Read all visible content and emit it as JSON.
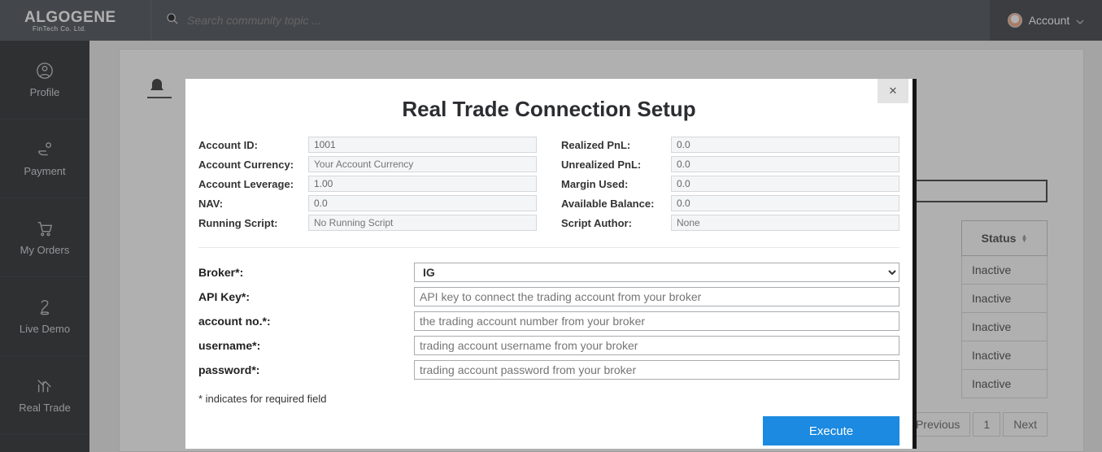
{
  "brand": {
    "name": "ALGOGENE",
    "sub": "FinTech Co. Ltd."
  },
  "search": {
    "placeholder": "Search community topic ..."
  },
  "account": {
    "label": "Account"
  },
  "sidebar": {
    "items": [
      {
        "label": "Profile"
      },
      {
        "label": "Payment"
      },
      {
        "label": "My Orders"
      },
      {
        "label": "Live Demo"
      },
      {
        "label": "Real Trade"
      }
    ]
  },
  "table": {
    "status_header": "Status",
    "rows": [
      {
        "status": "Inactive"
      },
      {
        "status": "Inactive"
      },
      {
        "status": "Inactive"
      },
      {
        "status": "Inactive"
      },
      {
        "status": "Inactive"
      }
    ],
    "pager": {
      "prev": "Previous",
      "page": "1",
      "next": "Next"
    }
  },
  "modal": {
    "title": "Real Trade Connection Setup",
    "left_fields": [
      {
        "label": "Account ID:",
        "value": "1001"
      },
      {
        "label": "Account Currency:",
        "value": "",
        "placeholder": "Your Account Currency"
      },
      {
        "label": "Account Leverage:",
        "value": "1.00"
      },
      {
        "label": "NAV:",
        "value": "0.0"
      },
      {
        "label": "Running Script:",
        "value": "",
        "placeholder": "No Running Script"
      }
    ],
    "right_fields": [
      {
        "label": "Realized PnL:",
        "value": "0.0"
      },
      {
        "label": "Unrealized PnL:",
        "value": "0.0"
      },
      {
        "label": "Margin Used:",
        "value": "0.0"
      },
      {
        "label": "Available Balance:",
        "value": "0.0"
      },
      {
        "label": "Script Author:",
        "value": "",
        "placeholder": "None"
      }
    ],
    "broker_rows": [
      {
        "label": "Broker*:",
        "type": "select",
        "value": "IG"
      },
      {
        "label": "API Key*:",
        "type": "text",
        "placeholder": "API key to connect the trading account from your broker"
      },
      {
        "label": "account no.*:",
        "type": "text",
        "placeholder": "the trading account number from your broker"
      },
      {
        "label": "username*:",
        "type": "text",
        "placeholder": "trading account username from your broker"
      },
      {
        "label": "password*:",
        "type": "text",
        "placeholder": "trading account password from your broker"
      }
    ],
    "required_note": "* indicates for required field",
    "execute": "Execute"
  }
}
